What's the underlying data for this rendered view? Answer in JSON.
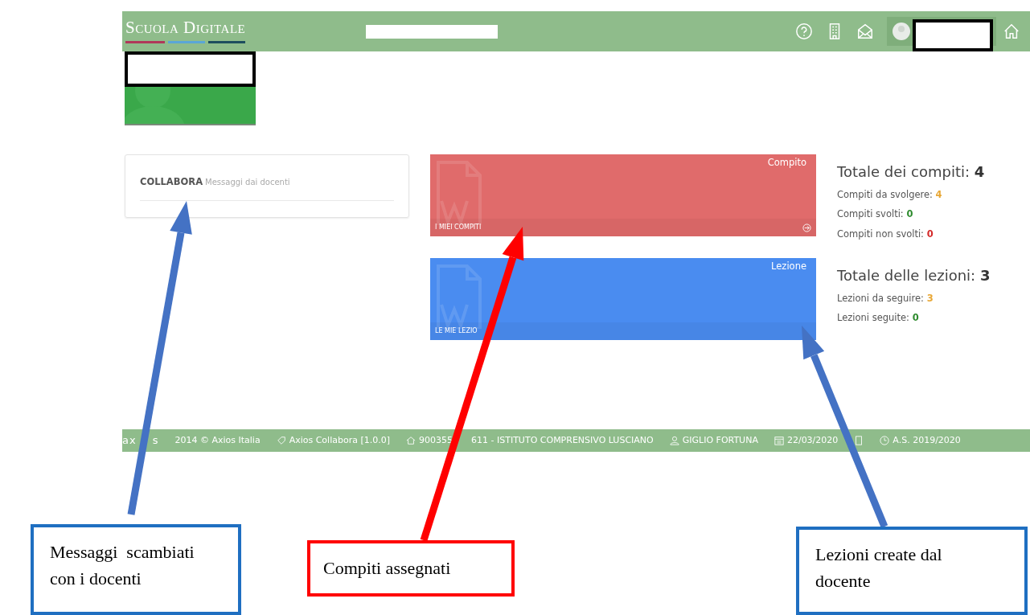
{
  "header": {
    "logo": "Scuola Digitale"
  },
  "collabora": {
    "title": "COLLABORA",
    "subtitle": "Messaggi dai docenti"
  },
  "tiles": [
    {
      "kind": "compiti",
      "corner": "Compito",
      "footer": "I MIEI COMPITI",
      "color": "#e06b6b"
    },
    {
      "kind": "lezioni",
      "corner": "Lezione",
      "footer": "LE MIE LEZIO",
      "color": "#4a8cf0"
    }
  ],
  "stats": [
    {
      "title": "Totale dei compiti:",
      "total": "4",
      "lines": [
        {
          "label": "Compiti da svolgere:",
          "value": "4",
          "color": "#e8a735"
        },
        {
          "label": "Compiti svolti:",
          "value": "0",
          "color": "#2e8b2e"
        },
        {
          "label": "Compiti non svolti:",
          "value": "0",
          "color": "#d42a2a"
        }
      ]
    },
    {
      "title": "Totale delle lezioni:",
      "total": "3",
      "lines": [
        {
          "label": "Lezioni da seguire:",
          "value": "3",
          "color": "#e8a735"
        },
        {
          "label": "Lezioni seguite:",
          "value": "0",
          "color": "#2e8b2e"
        }
      ]
    }
  ],
  "status_bar": [
    {
      "kind": "logo",
      "text": "ax"
    },
    {
      "kind": "logo",
      "text": "s"
    },
    {
      "kind": "plain",
      "text": "2014 © Axios Italia"
    },
    {
      "kind": "tag",
      "text": "Axios Collabora [1.0.0]"
    },
    {
      "kind": "home",
      "text": "900355"
    },
    {
      "kind": "plain",
      "text": "611 - ISTITUTO COMPRENSIVO LUSCIANO"
    },
    {
      "kind": "user",
      "text": "GIGLIO FORTUNA"
    },
    {
      "kind": "calendar",
      "text": "22/03/2020"
    },
    {
      "kind": "doc"
    },
    {
      "kind": "clock",
      "text": "A.S. 2019/2020"
    }
  ],
  "callouts": [
    {
      "text": "Messaggi  scambiati con i docenti",
      "color": "#1f6fc1"
    },
    {
      "text": "Compiti assegnati",
      "color": "#ff0000"
    },
    {
      "text": "Lezioni create dal docente",
      "color": "#1f6fc1"
    }
  ]
}
